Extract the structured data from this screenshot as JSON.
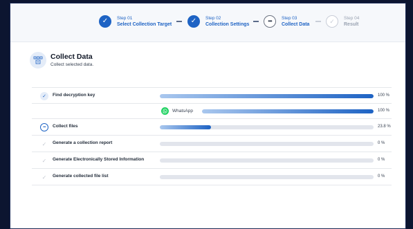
{
  "steps": [
    {
      "num": "Step 01",
      "title": "Select Collection Target",
      "status": "done"
    },
    {
      "num": "Step 02",
      "title": "Collection Settings",
      "status": "done"
    },
    {
      "num": "Step 03",
      "title": "Collect Data",
      "status": "current"
    },
    {
      "num": "Step 04",
      "title": "Result",
      "status": "pending"
    }
  ],
  "header": {
    "title": "Collect Data",
    "subtitle": "Collect selected data."
  },
  "tasks": [
    {
      "label": "Find decryption key",
      "percent_text": "100 %",
      "progress": 100,
      "status": "done"
    },
    {
      "sub_label": "WhatsApp",
      "percent_text": "100 %",
      "progress": 100
    },
    {
      "label": "Collect files",
      "percent_text": "23.8 %",
      "progress": 23.8,
      "status": "running"
    },
    {
      "label": "Generate a collection report",
      "percent_text": "0 %",
      "progress": 0,
      "status": "pending"
    },
    {
      "label": "Generate Electronically Stored Information",
      "percent_text": "0 %",
      "progress": 0,
      "status": "pending"
    },
    {
      "label": "Generate collected file list",
      "percent_text": "0 %",
      "progress": 0,
      "status": "pending"
    }
  ],
  "colors": {
    "accent": "#1e63c4",
    "track": "#e2e5ec",
    "whatsapp": "#25d366",
    "background": "#0c1530"
  },
  "icons": {
    "done_step": "check-icon",
    "current_step": "ellipsis-icon",
    "pending_step": "check-icon",
    "header": "data-collection-icon",
    "sub_app": "whatsapp-icon"
  }
}
